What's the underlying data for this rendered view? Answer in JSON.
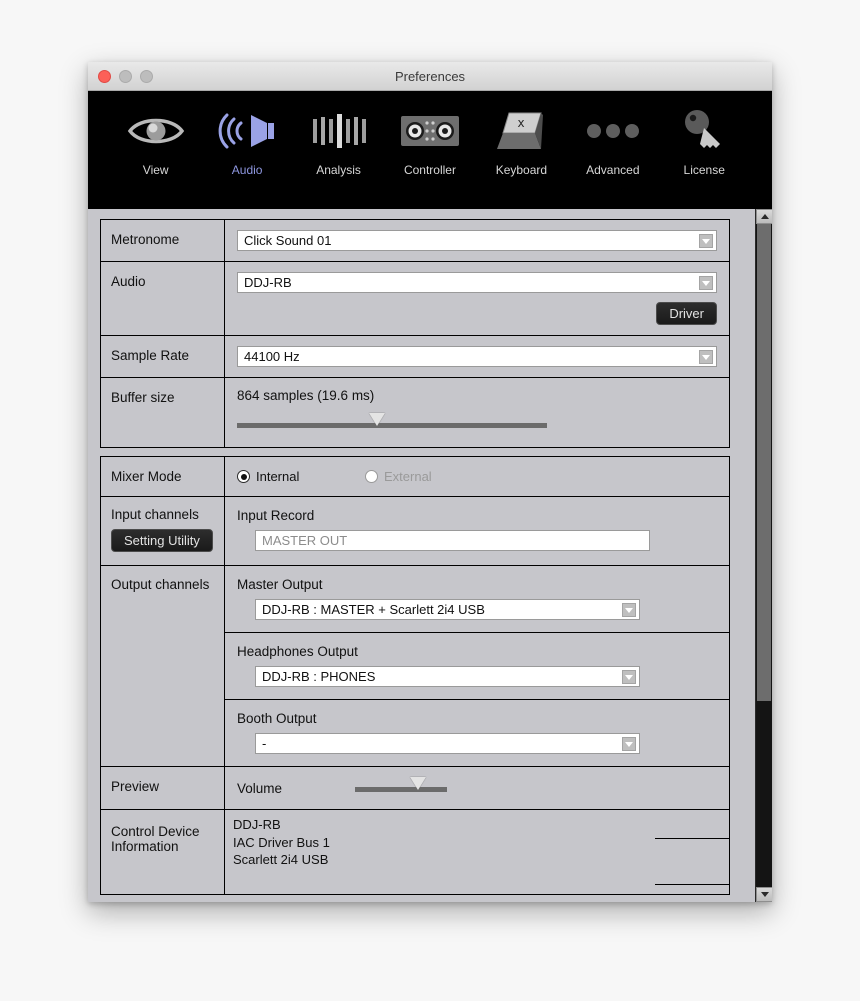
{
  "window": {
    "title": "Preferences",
    "traffic": {
      "close": "close-button",
      "minimize": "minimize-button",
      "maximize": "maximize-button"
    }
  },
  "toolbar": {
    "active": "Audio",
    "items": [
      {
        "label": "View",
        "icon": "eye-icon"
      },
      {
        "label": "Audio",
        "icon": "speaker-icon"
      },
      {
        "label": "Analysis",
        "icon": "waveform-bars-icon"
      },
      {
        "label": "Controller",
        "icon": "controller-icon"
      },
      {
        "label": "Keyboard",
        "icon": "keyboard-key-icon"
      },
      {
        "label": "Advanced",
        "icon": "ellipsis-icon"
      },
      {
        "label": "License",
        "icon": "key-icon"
      }
    ]
  },
  "colors": {
    "accent": "#8e97e0",
    "panel": "#c6c6cb",
    "toolbar_bg": "#000000",
    "close_red": "#fc6058"
  },
  "settings": {
    "metronome": {
      "label": "Metronome",
      "value": "Click Sound 01"
    },
    "audio": {
      "label": "Audio",
      "value": "DDJ-RB",
      "driver_button": "Driver"
    },
    "sample_rate": {
      "label": "Sample Rate",
      "value": "44100 Hz"
    },
    "buffer_size": {
      "label": "Buffer size",
      "value": "864 samples (19.6 ms)",
      "thumb_percent": 45
    },
    "mixer_mode": {
      "label": "Mixer Mode",
      "options": [
        {
          "label": "Internal",
          "selected": true,
          "disabled": false
        },
        {
          "label": "External",
          "selected": false,
          "disabled": true
        }
      ]
    },
    "input_channels": {
      "label": "Input channels",
      "setting_utility_button": "Setting Utility",
      "input_record": {
        "label": "Input Record",
        "value": "MASTER OUT"
      }
    },
    "output_channels": {
      "label": "Output channels",
      "master_output": {
        "label": "Master Output",
        "value": "DDJ-RB : MASTER + Scarlett 2i4 USB"
      },
      "headphones_output": {
        "label": "Headphones Output",
        "value": "DDJ-RB : PHONES"
      },
      "booth_output": {
        "label": "Booth Output",
        "value": "-"
      }
    },
    "preview": {
      "label": "Preview",
      "volume": {
        "label": "Volume",
        "thumb_percent": 68
      }
    },
    "control_device_information": {
      "label": "Control Device Information",
      "devices": [
        "DDJ-RB",
        "IAC Driver Bus 1",
        "Scarlett 2i4 USB"
      ]
    }
  },
  "scrollbar": {
    "up_arrow": "scroll-up-arrow",
    "down_arrow": "scroll-down-arrow",
    "thumb_percent": 72
  }
}
